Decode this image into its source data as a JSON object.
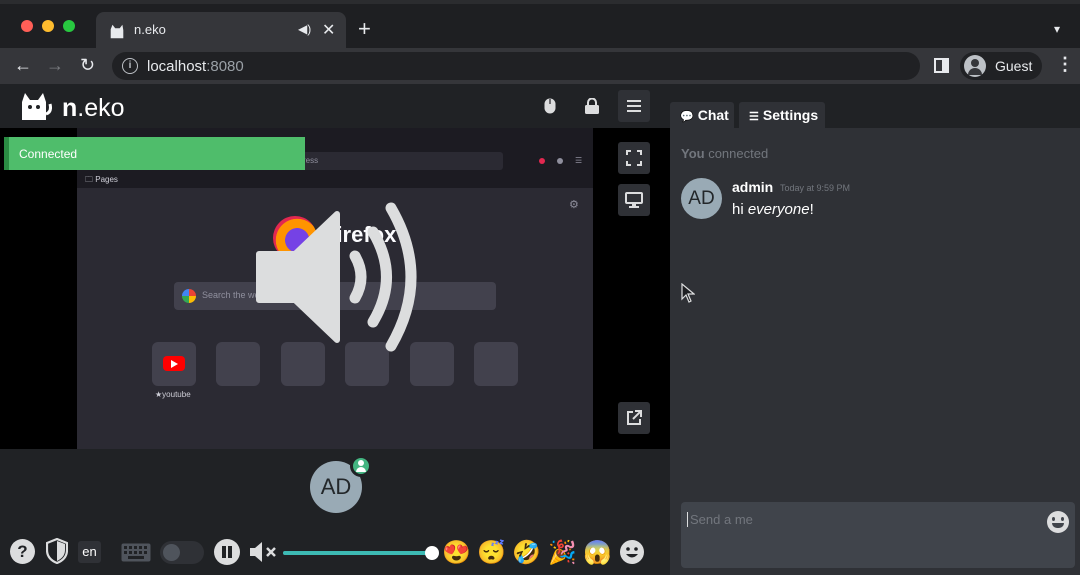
{
  "browser": {
    "tab": {
      "title": "n.eko",
      "audio_icon": "speaker-icon",
      "close_label": "✕"
    },
    "new_tab_label": "+",
    "omnibox": {
      "host": "localhost",
      "port": ":8080"
    },
    "profile": {
      "name": "Guest"
    }
  },
  "app": {
    "logo": {
      "prefix": "n",
      "suffix": ".eko"
    },
    "header_icons": [
      "mouse-icon",
      "lock-icon",
      "menu-icon"
    ],
    "notification": {
      "text": "Connected",
      "color": "#4fbd6b"
    },
    "remote_browser": {
      "bookmark_folder": "Pages",
      "brand": "Firefox",
      "search_placeholder": "Search the web",
      "url_placeholder": "ress",
      "top_site_label": "★youtube"
    },
    "member": {
      "initials": "AD"
    },
    "controls": {
      "language": "en",
      "volume": 0.99,
      "emojis": [
        "😍",
        "😴",
        "🤣",
        "🎉",
        "😱"
      ]
    }
  },
  "chat": {
    "tabs": [
      {
        "icon": "💬",
        "label": "Chat"
      },
      {
        "icon": "☰",
        "label": "Settings"
      }
    ],
    "status_user": "You",
    "status_text": " connected",
    "message": {
      "initials": "AD",
      "user": "admin",
      "time": "Today at 9:59 PM",
      "text_before": "hi ",
      "text_em": "everyone",
      "text_after": "!"
    },
    "input_placeholder": "Send a me"
  },
  "colors": {
    "accent": "#3dbab4",
    "success": "#43b581",
    "background": "#2f3136"
  }
}
